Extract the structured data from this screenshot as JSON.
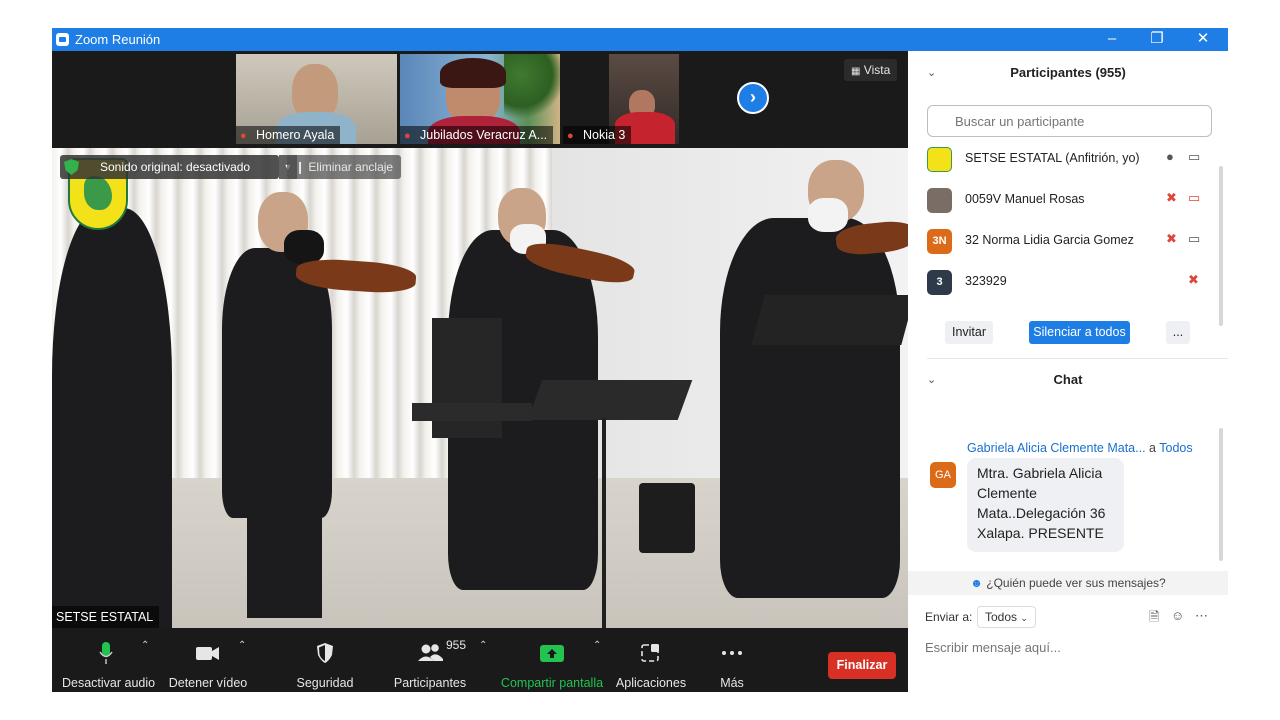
{
  "window": {
    "title": "Zoom Reunión"
  },
  "thumbnails": [
    {
      "name": "Homero Ayala",
      "muted": true
    },
    {
      "name": "Jubilados Veracruz A...",
      "muted": true
    },
    {
      "name": "Nokia 3",
      "muted": true
    }
  ],
  "view_button": "Vista",
  "main_video": {
    "original_sound": "Sonido original: desactivado",
    "unpin": "Eliminar anclaje",
    "speaker_name": "SETSE ESTATAL"
  },
  "toolbar": {
    "mute": "Desactivar audio",
    "stop_video": "Detener vídeo",
    "security": "Seguridad",
    "participants": "Participantes",
    "participants_count": "955",
    "share": "Compartir pantalla",
    "apps": "Aplicaciones",
    "more": "Más",
    "end": "Finalizar"
  },
  "participants_panel": {
    "title": "Participantes (955)",
    "search_placeholder": "Buscar un participante",
    "rows": [
      {
        "avatar": "",
        "name": "SETSE ESTATAL (Anfitrión, yo)"
      },
      {
        "avatar": "",
        "name": "0059V Manuel Rosas"
      },
      {
        "avatar": "3N",
        "name": "32 Norma Lidia Garcia Gomez"
      },
      {
        "avatar": "3",
        "name": "323929"
      }
    ],
    "invite": "Invitar",
    "mute_all": "Silenciar a todos",
    "more": "..."
  },
  "chat": {
    "title": "Chat",
    "from": "Gabriela Alicia Clemente Mata...",
    "to_prefix": "a",
    "to": "Todos",
    "avatar": "GA",
    "message": "Mtra. Gabriela Alicia Clemente Mata..Delegación 36 Xalapa. PRESENTE",
    "who_sees": "¿Quién puede ver sus mensajes?",
    "send_to_label": "Enviar a:",
    "send_to": "Todos",
    "input_placeholder": "Escribir mensaje aquí..."
  },
  "colors": {
    "accent": "#1e7ee6",
    "end": "#d93026",
    "share": "#23c351",
    "muted_red": "#e0453a"
  }
}
